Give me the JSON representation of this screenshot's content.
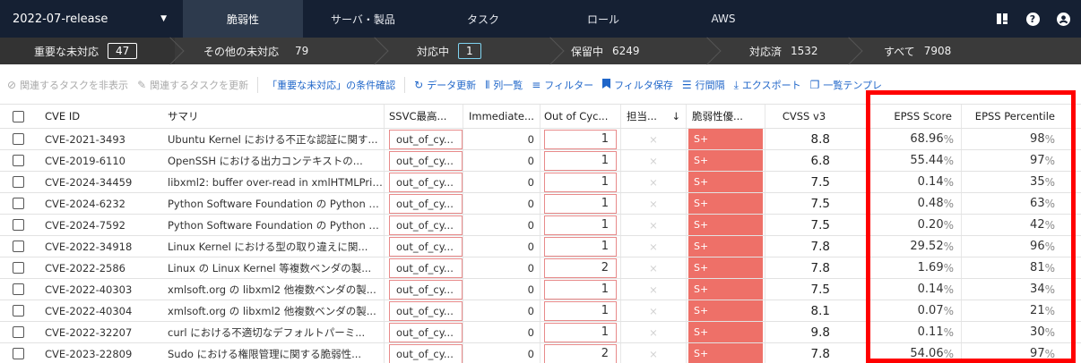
{
  "nav": {
    "project": "2022-07-release",
    "tabs": [
      "脆弱性",
      "サーバ・製品",
      "タスク",
      "ロール",
      "AWS"
    ]
  },
  "status": [
    {
      "label": "重要な未対応",
      "count": "47"
    },
    {
      "label": "その他の未対応",
      "count": "79"
    },
    {
      "label": "対応中",
      "count": "1"
    },
    {
      "label": "保留中",
      "count": "6249"
    },
    {
      "label": "対応済",
      "count": "1532"
    },
    {
      "label": "すべて",
      "count": "7908"
    }
  ],
  "toolbar": {
    "hide_related": "関連するタスクを非表示",
    "update_related": "関連するタスクを更新",
    "critical_conditions": "「重要な未対応」の条件確認",
    "refresh": "データ更新",
    "columns": "列一覧",
    "filter": "フィルター",
    "save_filter": "フィルタ保存",
    "row_spacing": "行間隔",
    "export": "エクスポート",
    "template": "一覧テンプレ"
  },
  "columns": {
    "cve": "CVE ID",
    "summary": "サマリ",
    "ssvc": "SSVC最高...",
    "immediate": "Immediate...",
    "ooc": "Out of Cyc...",
    "assignee": "担当...",
    "sort_arrow": "↓",
    "vuln_priority": "脆弱性優...",
    "cvss": "CVSS v3",
    "epss": "EPSS Score",
    "epss_pct": "EPSS Percentile"
  },
  "rows": [
    {
      "cve": "CVE-2021-3493",
      "summary": "Ubuntu Kernel における不正な認証に関す...",
      "ssvc": "out_of_cy...",
      "immediate": "0",
      "ooc": "1",
      "vp": "S+",
      "cvss": "8.8",
      "epss": "68.96",
      "epss_pct": "98"
    },
    {
      "cve": "CVE-2019-6110",
      "summary": "OpenSSH における出力コンテキストの...",
      "ssvc": "out_of_cy...",
      "immediate": "0",
      "ooc": "1",
      "vp": "S+",
      "cvss": "6.8",
      "epss": "55.44",
      "epss_pct": "97"
    },
    {
      "cve": "CVE-2024-34459",
      "summary": "libxml2: buffer over-read in xmlHTMLPrint...",
      "ssvc": "out_of_cy...",
      "immediate": "0",
      "ooc": "1",
      "vp": "S+",
      "cvss": "7.5",
      "epss": "0.14",
      "epss_pct": "35"
    },
    {
      "cve": "CVE-2024-6232",
      "summary": "Python Software Foundation の Python に...",
      "ssvc": "out_of_cy...",
      "immediate": "0",
      "ooc": "1",
      "vp": "S+",
      "cvss": "7.5",
      "epss": "0.48",
      "epss_pct": "63"
    },
    {
      "cve": "CVE-2024-7592",
      "summary": "Python Software Foundation の Python に...",
      "ssvc": "out_of_cy...",
      "immediate": "0",
      "ooc": "1",
      "vp": "S+",
      "cvss": "7.5",
      "epss": "0.20",
      "epss_pct": "42"
    },
    {
      "cve": "CVE-2022-34918",
      "summary": "Linux Kernel における型の取り違えに関...",
      "ssvc": "out_of_cy...",
      "immediate": "0",
      "ooc": "1",
      "vp": "S+",
      "cvss": "7.8",
      "epss": "29.52",
      "epss_pct": "96"
    },
    {
      "cve": "CVE-2022-2586",
      "summary": "Linux の Linux Kernel 等複数ベンダの製...",
      "ssvc": "out_of_cy...",
      "immediate": "0",
      "ooc": "2",
      "vp": "S+",
      "cvss": "7.8",
      "epss": "1.69",
      "epss_pct": "81"
    },
    {
      "cve": "CVE-2022-40303",
      "summary": "xmlsoft.org の libxml2 他複数ベンダの製...",
      "ssvc": "out_of_cy...",
      "immediate": "0",
      "ooc": "1",
      "vp": "S+",
      "cvss": "7.5",
      "epss": "0.14",
      "epss_pct": "34"
    },
    {
      "cve": "CVE-2022-40304",
      "summary": "xmlsoft.org の libxml2 他複数ベンダの製...",
      "ssvc": "out_of_cy...",
      "immediate": "0",
      "ooc": "1",
      "vp": "S+",
      "cvss": "8.1",
      "epss": "0.07",
      "epss_pct": "21"
    },
    {
      "cve": "CVE-2022-32207",
      "summary": "curl における不適切なデフォルトパーミ...",
      "ssvc": "out_of_cy...",
      "immediate": "0",
      "ooc": "1",
      "vp": "S+",
      "cvss": "9.8",
      "epss": "0.11",
      "epss_pct": "30"
    },
    {
      "cve": "CVE-2023-22809",
      "summary": "Sudo における権限管理に関する脆弱性...",
      "ssvc": "out_of_cy...",
      "immediate": "0",
      "ooc": "2",
      "vp": "S+",
      "cvss": "7.8",
      "epss": "54.06",
      "epss_pct": "97"
    }
  ],
  "percent_sign": "%",
  "colors": {
    "nav_bg": "#152033",
    "status_bg": "#3a3a3a",
    "priority_red": "#ee7068",
    "link_blue": "#1f66c9",
    "highlight": "#ff0000"
  },
  "icons": {
    "cross": "×"
  }
}
